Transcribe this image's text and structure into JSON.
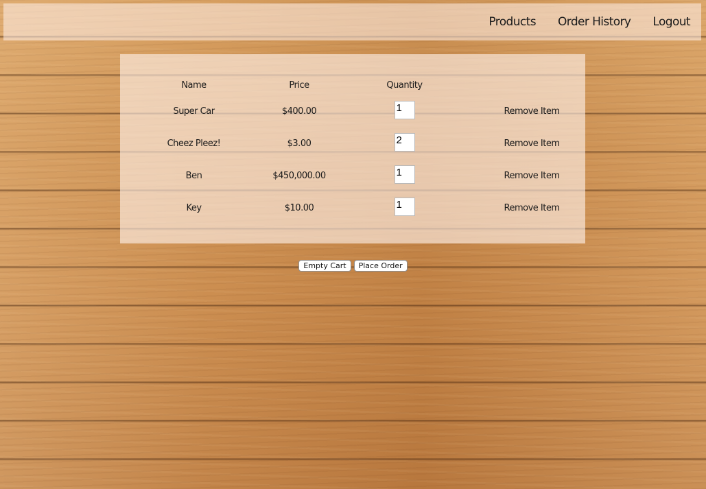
{
  "nav": {
    "links": [
      "Products",
      "Order History",
      "Logout"
    ]
  },
  "cart": {
    "headers": {
      "name": "Name",
      "price": "Price",
      "quantity": "Quantity",
      "remove": ""
    },
    "items": [
      {
        "name": "Super Car",
        "price": "$400.00",
        "quantity": "1",
        "remove_label": "Remove Item"
      },
      {
        "name": "Cheez Pleez!",
        "price": "$3.00",
        "quantity": "2",
        "remove_label": "Remove Item"
      },
      {
        "name": "Ben",
        "price": "$450,000.00",
        "quantity": "1",
        "remove_label": "Remove Item"
      },
      {
        "name": "Key",
        "price": "$10.00",
        "quantity": "1",
        "remove_label": "Remove Item"
      }
    ]
  },
  "actions": {
    "empty_cart_label": "Empty Cart",
    "place_order_label": "Place Order"
  },
  "colors": {
    "nav_background": "#fff0eb",
    "panel_background": "#fff2eb",
    "wood": "#c98a4a"
  }
}
